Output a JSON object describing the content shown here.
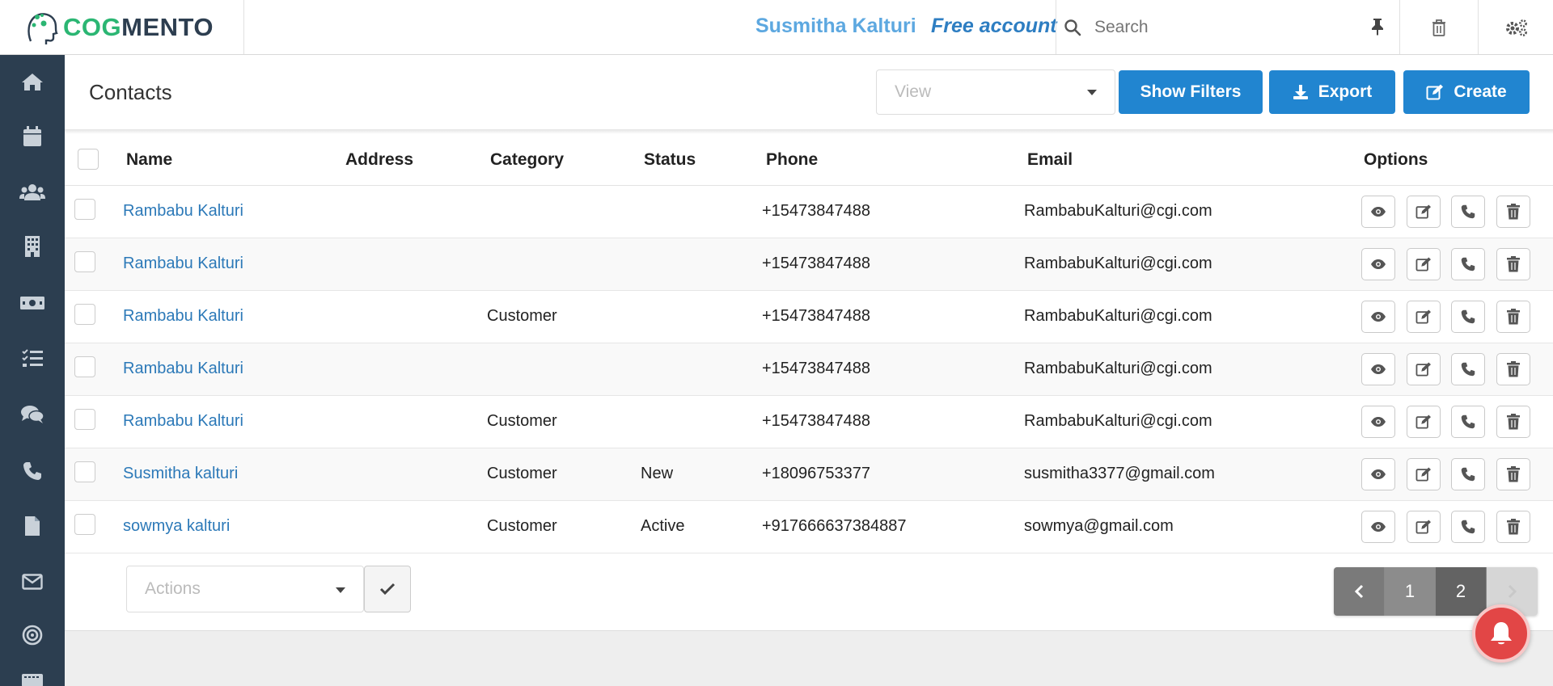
{
  "app": {
    "logo_text_1": "COG",
    "logo_text_2": "MENTO",
    "user_name": "Susmitha Kalturi",
    "account_type": "Free account",
    "search_placeholder": "Search"
  },
  "sidebar": {
    "icons": [
      "home-icon",
      "calendar-icon",
      "users-icon",
      "building-icon",
      "money-icon",
      "tasks-icon",
      "comments-icon",
      "phone-icon",
      "document-icon",
      "envelope-icon",
      "target-icon",
      "keyboard-icon"
    ]
  },
  "page": {
    "title": "Contacts",
    "view_placeholder": "View",
    "show_filters_label": "Show Filters",
    "export_label": "Export",
    "create_label": "Create"
  },
  "table": {
    "columns": [
      "Name",
      "Address",
      "Category",
      "Status",
      "Phone",
      "Email",
      "Options"
    ],
    "rows": [
      {
        "name": "Rambabu Kalturi",
        "address": "",
        "category": "",
        "status": "",
        "phone": "+15473847488",
        "email": "RambabuKalturi@cgi.com"
      },
      {
        "name": "Rambabu Kalturi",
        "address": "",
        "category": "",
        "status": "",
        "phone": "+15473847488",
        "email": "RambabuKalturi@cgi.com"
      },
      {
        "name": "Rambabu Kalturi",
        "address": "",
        "category": "Customer",
        "status": "",
        "phone": "+15473847488",
        "email": "RambabuKalturi@cgi.com"
      },
      {
        "name": "Rambabu Kalturi",
        "address": "",
        "category": "",
        "status": "",
        "phone": "+15473847488",
        "email": "RambabuKalturi@cgi.com"
      },
      {
        "name": "Rambabu Kalturi",
        "address": "",
        "category": "Customer",
        "status": "",
        "phone": "+15473847488",
        "email": "RambabuKalturi@cgi.com"
      },
      {
        "name": "Susmitha kalturi",
        "address": "",
        "category": "Customer",
        "status": "New",
        "phone": "+18096753377",
        "email": "susmitha3377@gmail.com"
      },
      {
        "name": "sowmya kalturi",
        "address": "",
        "category": "Customer",
        "status": "Active",
        "phone": "+917666637384887",
        "email": "sowmya@gmail.com"
      }
    ]
  },
  "footer": {
    "actions_placeholder": "Actions",
    "pages": [
      "1",
      "2"
    ],
    "current_page": "2"
  },
  "colors": {
    "primary": "#2185d0",
    "sidebar": "#2c3e50",
    "link": "#2c79b8",
    "logo_green": "#2bb673",
    "notification": "#e24646"
  }
}
